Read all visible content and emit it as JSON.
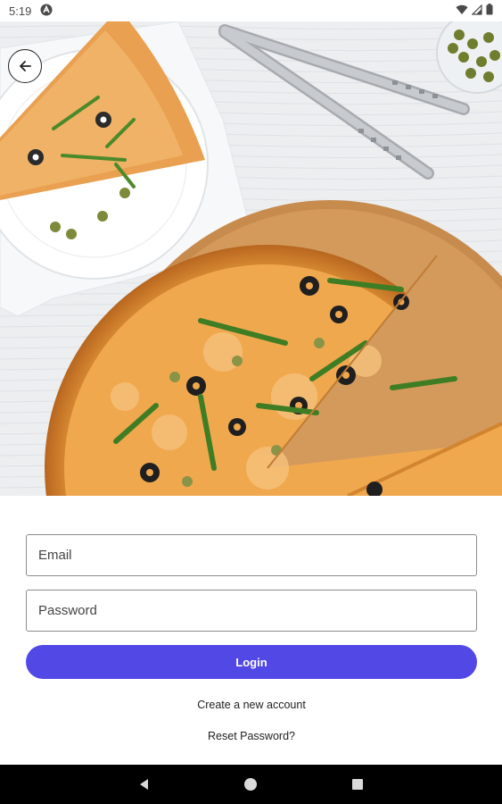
{
  "status_bar": {
    "time": "5:19",
    "icons": [
      "notification-icon",
      "wifi-icon",
      "signal-icon",
      "battery-icon"
    ]
  },
  "hero": {
    "image": "pizza-photo",
    "back_icon": "arrow-left-icon"
  },
  "form": {
    "email": {
      "placeholder": "Email",
      "value": ""
    },
    "password": {
      "placeholder": "Password",
      "value": ""
    },
    "login_label": "Login",
    "create_account_label": "Create a new account",
    "reset_password_label": "Reset Password?"
  },
  "nav": {
    "icons": [
      "back-triangle-icon",
      "home-circle-icon",
      "recents-square-icon"
    ]
  },
  "colors": {
    "accent": "#5148e6",
    "nav_bar": "#000000",
    "background": "#ffffff"
  }
}
